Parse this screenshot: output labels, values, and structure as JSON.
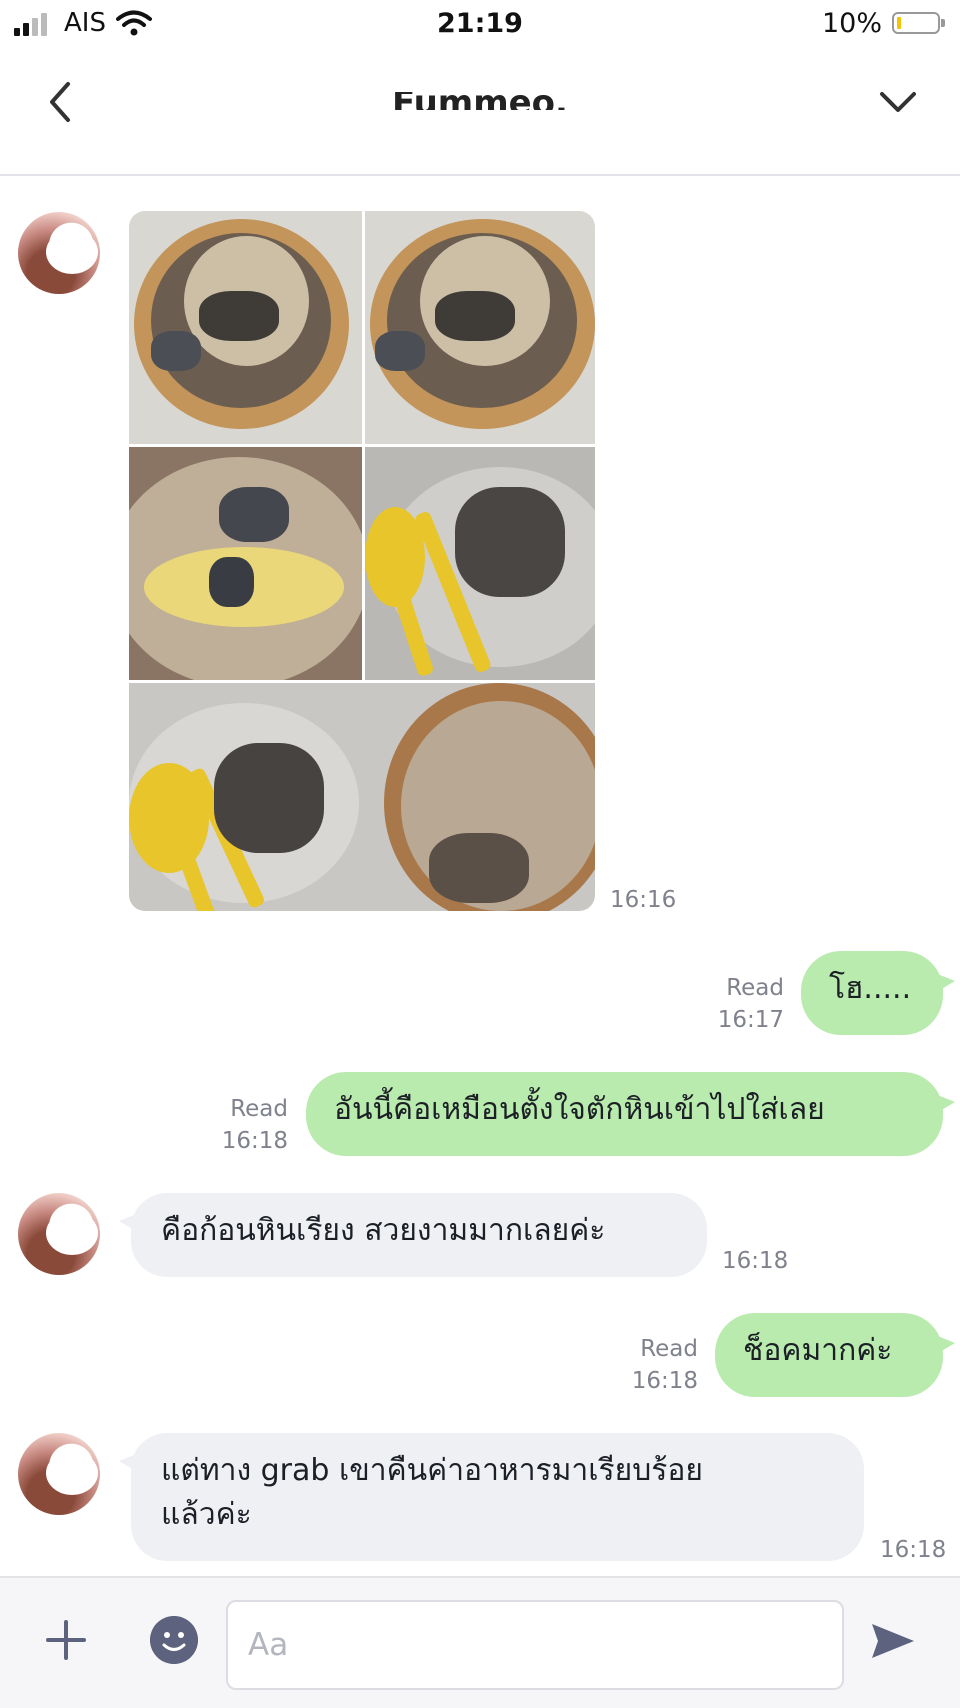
{
  "status_bar": {
    "carrier": "AIS",
    "time": "21:19",
    "battery": "10%"
  },
  "header": {
    "title": "Fummeo."
  },
  "messages": [
    {
      "id": "m1",
      "direction": "in",
      "type": "image_grid",
      "time": "16:16",
      "photo_count": 6
    },
    {
      "id": "m2",
      "direction": "out",
      "text": "โฮ.....",
      "read": "Read",
      "time": "16:17"
    },
    {
      "id": "m3",
      "direction": "out",
      "text": "อันนี้คือเหมือนตั้งใจตักหินเข้าไปใส่เลย",
      "read": "Read",
      "time": "16:18"
    },
    {
      "id": "m4",
      "direction": "in",
      "text": "คือก้อนหินเรียง สวยงามมากเลยค่ะ",
      "time": "16:18"
    },
    {
      "id": "m5",
      "direction": "out",
      "text": "ช็อคมากค่ะ",
      "read": "Read",
      "time": "16:18"
    },
    {
      "id": "m6",
      "direction": "in",
      "text_line1": "แต่ทาง grab เขาคืนค่าอาหารมาเรียบร้อย",
      "text_line2": "แล้วค่ะ",
      "time": "16:18"
    }
  ],
  "input": {
    "placeholder": "Aa"
  },
  "colors": {
    "outgoing_bubble": "#b9ebae",
    "incoming_bubble": "#eef0f4",
    "icon": "#5d637e"
  }
}
